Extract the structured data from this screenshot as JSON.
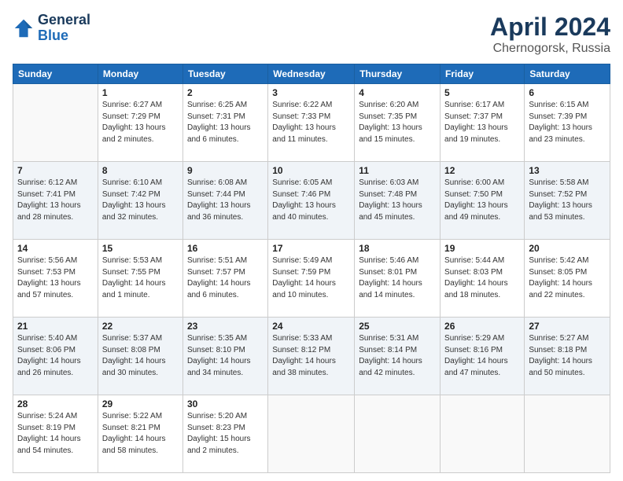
{
  "logo": {
    "line1": "General",
    "line2": "Blue"
  },
  "title": "April 2024",
  "subtitle": "Chernogorsk, Russia",
  "days_of_week": [
    "Sunday",
    "Monday",
    "Tuesday",
    "Wednesday",
    "Thursday",
    "Friday",
    "Saturday"
  ],
  "weeks": [
    [
      {
        "day": "",
        "info": ""
      },
      {
        "day": "1",
        "info": "Sunrise: 6:27 AM\nSunset: 7:29 PM\nDaylight: 13 hours\nand 2 minutes."
      },
      {
        "day": "2",
        "info": "Sunrise: 6:25 AM\nSunset: 7:31 PM\nDaylight: 13 hours\nand 6 minutes."
      },
      {
        "day": "3",
        "info": "Sunrise: 6:22 AM\nSunset: 7:33 PM\nDaylight: 13 hours\nand 11 minutes."
      },
      {
        "day": "4",
        "info": "Sunrise: 6:20 AM\nSunset: 7:35 PM\nDaylight: 13 hours\nand 15 minutes."
      },
      {
        "day": "5",
        "info": "Sunrise: 6:17 AM\nSunset: 7:37 PM\nDaylight: 13 hours\nand 19 minutes."
      },
      {
        "day": "6",
        "info": "Sunrise: 6:15 AM\nSunset: 7:39 PM\nDaylight: 13 hours\nand 23 minutes."
      }
    ],
    [
      {
        "day": "7",
        "info": "Sunrise: 6:12 AM\nSunset: 7:41 PM\nDaylight: 13 hours\nand 28 minutes."
      },
      {
        "day": "8",
        "info": "Sunrise: 6:10 AM\nSunset: 7:42 PM\nDaylight: 13 hours\nand 32 minutes."
      },
      {
        "day": "9",
        "info": "Sunrise: 6:08 AM\nSunset: 7:44 PM\nDaylight: 13 hours\nand 36 minutes."
      },
      {
        "day": "10",
        "info": "Sunrise: 6:05 AM\nSunset: 7:46 PM\nDaylight: 13 hours\nand 40 minutes."
      },
      {
        "day": "11",
        "info": "Sunrise: 6:03 AM\nSunset: 7:48 PM\nDaylight: 13 hours\nand 45 minutes."
      },
      {
        "day": "12",
        "info": "Sunrise: 6:00 AM\nSunset: 7:50 PM\nDaylight: 13 hours\nand 49 minutes."
      },
      {
        "day": "13",
        "info": "Sunrise: 5:58 AM\nSunset: 7:52 PM\nDaylight: 13 hours\nand 53 minutes."
      }
    ],
    [
      {
        "day": "14",
        "info": "Sunrise: 5:56 AM\nSunset: 7:53 PM\nDaylight: 13 hours\nand 57 minutes."
      },
      {
        "day": "15",
        "info": "Sunrise: 5:53 AM\nSunset: 7:55 PM\nDaylight: 14 hours\nand 1 minute."
      },
      {
        "day": "16",
        "info": "Sunrise: 5:51 AM\nSunset: 7:57 PM\nDaylight: 14 hours\nand 6 minutes."
      },
      {
        "day": "17",
        "info": "Sunrise: 5:49 AM\nSunset: 7:59 PM\nDaylight: 14 hours\nand 10 minutes."
      },
      {
        "day": "18",
        "info": "Sunrise: 5:46 AM\nSunset: 8:01 PM\nDaylight: 14 hours\nand 14 minutes."
      },
      {
        "day": "19",
        "info": "Sunrise: 5:44 AM\nSunset: 8:03 PM\nDaylight: 14 hours\nand 18 minutes."
      },
      {
        "day": "20",
        "info": "Sunrise: 5:42 AM\nSunset: 8:05 PM\nDaylight: 14 hours\nand 22 minutes."
      }
    ],
    [
      {
        "day": "21",
        "info": "Sunrise: 5:40 AM\nSunset: 8:06 PM\nDaylight: 14 hours\nand 26 minutes."
      },
      {
        "day": "22",
        "info": "Sunrise: 5:37 AM\nSunset: 8:08 PM\nDaylight: 14 hours\nand 30 minutes."
      },
      {
        "day": "23",
        "info": "Sunrise: 5:35 AM\nSunset: 8:10 PM\nDaylight: 14 hours\nand 34 minutes."
      },
      {
        "day": "24",
        "info": "Sunrise: 5:33 AM\nSunset: 8:12 PM\nDaylight: 14 hours\nand 38 minutes."
      },
      {
        "day": "25",
        "info": "Sunrise: 5:31 AM\nSunset: 8:14 PM\nDaylight: 14 hours\nand 42 minutes."
      },
      {
        "day": "26",
        "info": "Sunrise: 5:29 AM\nSunset: 8:16 PM\nDaylight: 14 hours\nand 47 minutes."
      },
      {
        "day": "27",
        "info": "Sunrise: 5:27 AM\nSunset: 8:18 PM\nDaylight: 14 hours\nand 50 minutes."
      }
    ],
    [
      {
        "day": "28",
        "info": "Sunrise: 5:24 AM\nSunset: 8:19 PM\nDaylight: 14 hours\nand 54 minutes."
      },
      {
        "day": "29",
        "info": "Sunrise: 5:22 AM\nSunset: 8:21 PM\nDaylight: 14 hours\nand 58 minutes."
      },
      {
        "day": "30",
        "info": "Sunrise: 5:20 AM\nSunset: 8:23 PM\nDaylight: 15 hours\nand 2 minutes."
      },
      {
        "day": "",
        "info": ""
      },
      {
        "day": "",
        "info": ""
      },
      {
        "day": "",
        "info": ""
      },
      {
        "day": "",
        "info": ""
      }
    ]
  ]
}
